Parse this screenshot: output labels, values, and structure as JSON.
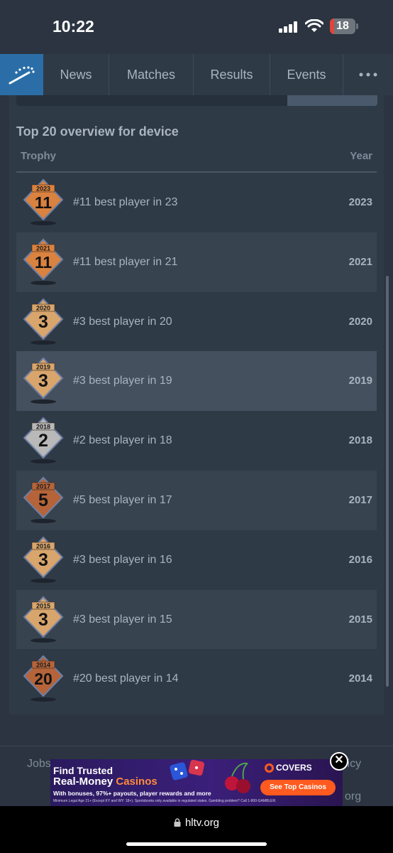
{
  "status": {
    "time": "10:22",
    "battery": "18"
  },
  "nav": {
    "items": [
      {
        "label": "News"
      },
      {
        "label": "Matches"
      },
      {
        "label": "Results"
      },
      {
        "label": "Events"
      }
    ],
    "more_icon": "ellipsis-icon"
  },
  "section": {
    "title": "Top 20 overview for device",
    "col_trophy": "Trophy",
    "col_year": "Year"
  },
  "rows": [
    {
      "trophy_year": "2023",
      "rank": "11",
      "label": "#11 best player in 23",
      "year": "2023",
      "tier": "bronze"
    },
    {
      "trophy_year": "2021",
      "rank": "11",
      "label": "#11 best player in 21",
      "year": "2021",
      "tier": "bronze"
    },
    {
      "trophy_year": "2020",
      "rank": "3",
      "label": "#3 best player in 20",
      "year": "2020",
      "tier": "gold"
    },
    {
      "trophy_year": "2019",
      "rank": "3",
      "label": "#3 best player in 19",
      "year": "2019",
      "tier": "gold"
    },
    {
      "trophy_year": "2018",
      "rank": "2",
      "label": "#2 best player in 18",
      "year": "2018",
      "tier": "silver"
    },
    {
      "trophy_year": "2017",
      "rank": "5",
      "label": "#5 best player in 17",
      "year": "2017",
      "tier": "copper"
    },
    {
      "trophy_year": "2016",
      "rank": "3",
      "label": "#3 best player in 16",
      "year": "2016",
      "tier": "gold"
    },
    {
      "trophy_year": "2015",
      "rank": "3",
      "label": "#3 best player in 15",
      "year": "2015",
      "tier": "gold"
    },
    {
      "trophy_year": "2014",
      "rank": "20",
      "label": "#20 best player in 14",
      "year": "2014",
      "tier": "copper"
    }
  ],
  "colors": {
    "bronze": "#d9823f",
    "gold": "#d8a56c",
    "silver": "#b8b8b8",
    "copper": "#b5643a"
  },
  "footer": {
    "links": [
      "Jobs",
      "licy",
      "org"
    ]
  },
  "ad": {
    "title1": "Find Trusted",
    "title2a": "Real-Money ",
    "title2b": "Casinos",
    "sub": "With bonuses, 97%+ payouts, player rewards and more",
    "fine": "Minimum Legal Age 21+ (Except KY and WY: 18+). Sportsbooks only available in regulated states. Gambling problem? Call 1-800-GAMBLER.",
    "brand": "COVERS",
    "cta": "See Top Casinos",
    "close": "✕"
  },
  "browser": {
    "url": "hltv.org"
  }
}
